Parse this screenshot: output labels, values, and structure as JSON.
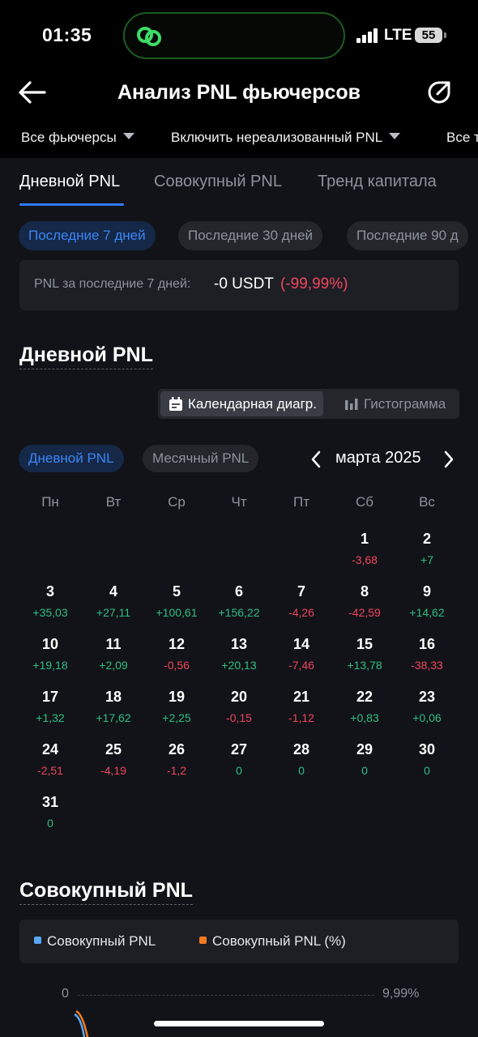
{
  "status_bar": {
    "time": "01:35",
    "network": "LTE",
    "battery": "55"
  },
  "header": {
    "title": "Анализ PNL фьючерсов"
  },
  "filters": [
    {
      "label": "Все фьючерсы"
    },
    {
      "label": "Включить нереализованный PNL"
    },
    {
      "label": "Все т"
    }
  ],
  "tabs": [
    {
      "label": "Дневной PNL"
    },
    {
      "label": "Совокупный PNL"
    },
    {
      "label": "Тренд капитала"
    }
  ],
  "periods": [
    {
      "label": "Последние 7 дней"
    },
    {
      "label": "Последние 30 дней"
    },
    {
      "label": "Последние 90 д"
    }
  ],
  "summary": {
    "label": "PNL за последние 7 дней:",
    "value": "-0 USDT",
    "percent": "(-99,99%)"
  },
  "daily_section": {
    "title": "Дневной PNL",
    "view_calendar": "Календарная диагр.",
    "view_histogram": "Гистограмма",
    "chip_daily": "Дневной PNL",
    "chip_monthly": "Месячный PNL",
    "month": "марта 2025"
  },
  "weekdays": [
    "Пн",
    "Вт",
    "Ср",
    "Чт",
    "Пт",
    "Сб",
    "Вс"
  ],
  "calendar": [
    {
      "day": "1",
      "pnl": "-3,68"
    },
    {
      "day": "2",
      "pnl": "+7"
    },
    {
      "day": "3",
      "pnl": "+35,03"
    },
    {
      "day": "4",
      "pnl": "+27,11"
    },
    {
      "day": "5",
      "pnl": "+100,61"
    },
    {
      "day": "6",
      "pnl": "+156,22"
    },
    {
      "day": "7",
      "pnl": "-4,26"
    },
    {
      "day": "8",
      "pnl": "-42,59"
    },
    {
      "day": "9",
      "pnl": "+14,62"
    },
    {
      "day": "10",
      "pnl": "+19,18"
    },
    {
      "day": "11",
      "pnl": "+2,09"
    },
    {
      "day": "12",
      "pnl": "-0,56"
    },
    {
      "day": "13",
      "pnl": "+20,13"
    },
    {
      "day": "14",
      "pnl": "-7,46"
    },
    {
      "day": "15",
      "pnl": "+13,78"
    },
    {
      "day": "16",
      "pnl": "-38,33"
    },
    {
      "day": "17",
      "pnl": "+1,32"
    },
    {
      "day": "18",
      "pnl": "+17,62"
    },
    {
      "day": "19",
      "pnl": "+2,25"
    },
    {
      "day": "20",
      "pnl": "-0,15"
    },
    {
      "day": "21",
      "pnl": "-1,12"
    },
    {
      "day": "22",
      "pnl": "+0,83"
    },
    {
      "day": "23",
      "pnl": "+0,06"
    },
    {
      "day": "24",
      "pnl": "-2,51"
    },
    {
      "day": "25",
      "pnl": "-4,19"
    },
    {
      "day": "26",
      "pnl": "-1,2"
    },
    {
      "day": "27",
      "pnl": "0"
    },
    {
      "day": "28",
      "pnl": "0"
    },
    {
      "day": "29",
      "pnl": "0"
    },
    {
      "day": "30",
      "pnl": "0"
    },
    {
      "day": "31",
      "pnl": "0"
    }
  ],
  "cumulative_section": {
    "title": "Совокупный PNL",
    "legend_pnl": "Совокупный PNL",
    "legend_pct": "Совокупный PNL (%)",
    "axis_left": "0",
    "axis_right": "9,99%"
  },
  "colors": {
    "accent": "#2f7bf5",
    "positive": "#2fbf83",
    "negative": "#f0455e",
    "legend_pnl": "#5aa8f5",
    "legend_pct": "#f27b22"
  }
}
